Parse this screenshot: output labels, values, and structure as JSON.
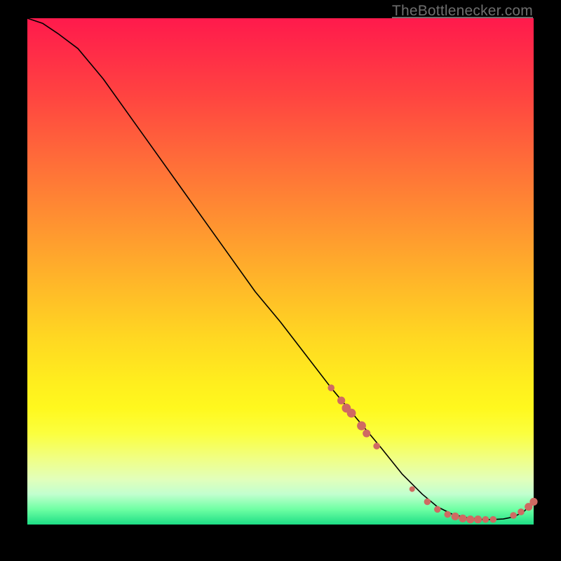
{
  "attribution": {
    "text": "TheBottlenecker.com",
    "href": "#"
  },
  "colors": {
    "curve": "#000000",
    "dot": "#cf6a62",
    "background_top": "#ff1a4c",
    "background_bottom": "#1dde85"
  },
  "chart_data": {
    "type": "line",
    "title": "",
    "xlabel": "",
    "ylabel": "",
    "xlim": [
      0,
      100
    ],
    "ylim": [
      0,
      100
    ],
    "note": "No axes, ticks, or legend are rendered in the source image. Values are read off the background gradient scale (0 = bottom/green, 100 = top/red).",
    "series": [
      {
        "name": "curve",
        "x": [
          0,
          3,
          6,
          10,
          15,
          20,
          25,
          30,
          35,
          40,
          45,
          50,
          55,
          60,
          65,
          70,
          74,
          78,
          81,
          84,
          87,
          90,
          92,
          94,
          96,
          98,
          100
        ],
        "y": [
          100,
          99,
          97,
          94,
          88,
          81,
          74,
          67,
          60,
          53,
          46,
          40,
          33.5,
          27,
          21,
          15,
          10,
          6,
          3.5,
          2,
          1.3,
          1,
          1,
          1.1,
          1.5,
          2.5,
          4.5
        ]
      }
    ],
    "markers": [
      {
        "name": "dots_descending_segment",
        "points": [
          {
            "x": 60,
            "y": 27,
            "r": 0.6
          },
          {
            "x": 62,
            "y": 24.5,
            "r": 0.7
          },
          {
            "x": 63,
            "y": 23,
            "r": 0.8
          },
          {
            "x": 64,
            "y": 22,
            "r": 0.8
          },
          {
            "x": 66,
            "y": 19.5,
            "r": 0.8
          },
          {
            "x": 67,
            "y": 18,
            "r": 0.7
          },
          {
            "x": 69,
            "y": 15.5,
            "r": 0.6
          }
        ]
      },
      {
        "name": "dots_valley_cluster",
        "points": [
          {
            "x": 76,
            "y": 7,
            "r": 0.5
          },
          {
            "x": 79,
            "y": 4.5,
            "r": 0.6
          },
          {
            "x": 81,
            "y": 3,
            "r": 0.6
          },
          {
            "x": 83,
            "y": 2,
            "r": 0.6
          },
          {
            "x": 84.5,
            "y": 1.6,
            "r": 0.7
          },
          {
            "x": 86,
            "y": 1.2,
            "r": 0.7
          },
          {
            "x": 87.5,
            "y": 1,
            "r": 0.7
          },
          {
            "x": 89,
            "y": 1,
            "r": 0.7
          },
          {
            "x": 90.5,
            "y": 1,
            "r": 0.6
          },
          {
            "x": 92,
            "y": 1,
            "r": 0.6
          }
        ]
      },
      {
        "name": "dots_rising_tail",
        "points": [
          {
            "x": 96,
            "y": 1.8,
            "r": 0.6
          },
          {
            "x": 97.5,
            "y": 2.5,
            "r": 0.6
          },
          {
            "x": 99,
            "y": 3.5,
            "r": 0.7
          },
          {
            "x": 100,
            "y": 4.5,
            "r": 0.7
          }
        ]
      }
    ]
  }
}
